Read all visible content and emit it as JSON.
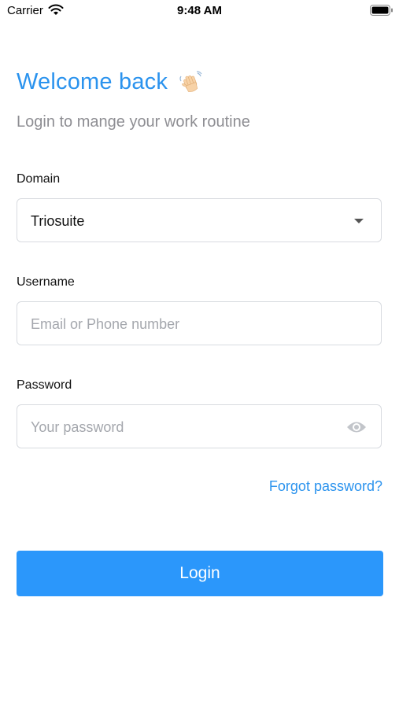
{
  "status_bar": {
    "carrier": "Carrier",
    "time": "9:48 AM",
    "wifi_icon": "wifi-icon",
    "battery_icon": "battery-icon"
  },
  "header": {
    "title": "Welcome back",
    "title_icon": "waving-hand-emoji",
    "subtitle": "Login to mange your work routine"
  },
  "form": {
    "domain": {
      "label": "Domain",
      "value": "Triosuite",
      "icon": "chevron-down-icon"
    },
    "username": {
      "label": "Username",
      "placeholder": "Email or Phone number",
      "value": ""
    },
    "password": {
      "label": "Password",
      "placeholder": "Your password",
      "value": "",
      "icon": "eye-icon"
    },
    "forgot_link": "Forgot password?",
    "submit_label": "Login"
  },
  "colors": {
    "accent": "#2b93ee",
    "button": "#2b97fb",
    "muted_text": "#8e8e93",
    "placeholder": "#a4a7ad",
    "border": "#d8dbe0"
  }
}
